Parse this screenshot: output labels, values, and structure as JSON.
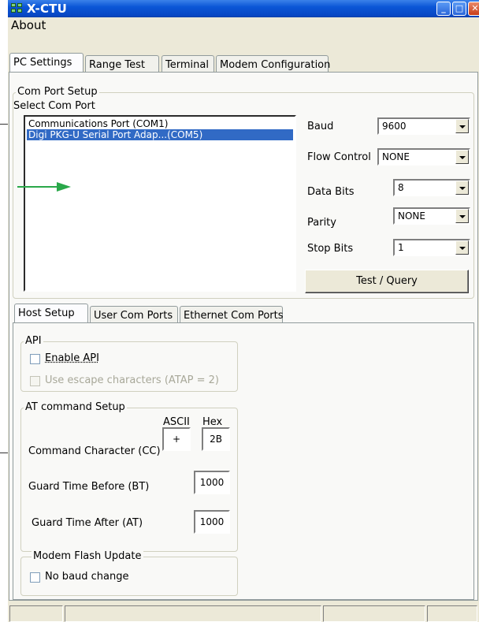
{
  "window": {
    "title": "X-CTU"
  },
  "menu": {
    "about": "About"
  },
  "main_tabs": [
    "PC Settings",
    "Range Test",
    "Terminal",
    "Modem Configuration"
  ],
  "com_port": {
    "group_title": "Com Port Setup",
    "select_label": "Select Com Port",
    "ports": [
      "Communications Port (COM1)",
      "Digi PKG-U Serial Port Adap...(COM5)"
    ],
    "selected_index": 1
  },
  "settings": {
    "baud": {
      "label": "Baud",
      "value": "9600"
    },
    "flow_control": {
      "label": "Flow Control",
      "value": "NONE"
    },
    "data_bits": {
      "label": "Data Bits",
      "value": "8"
    },
    "parity": {
      "label": "Parity",
      "value": "NONE"
    },
    "stop_bits": {
      "label": "Stop Bits",
      "value": "1"
    },
    "test_button": "Test / Query"
  },
  "sub_tabs": [
    "Host Setup",
    "User Com Ports",
    "Ethernet Com Ports"
  ],
  "api": {
    "group_title": "API",
    "enable_api": "Enable API",
    "escape_chars": "Use escape characters (ATAP = 2)"
  },
  "at_setup": {
    "group_title": "AT command Setup",
    "ascii_header": "ASCII",
    "hex_header": "Hex",
    "cc_label": "Command Character (CC)",
    "cc_ascii": "+",
    "cc_hex": "2B",
    "bt_label": "Guard Time Before (BT)",
    "bt_value": "1000",
    "at_label": "Guard Time After (AT)",
    "at_value": "1000"
  },
  "flash": {
    "group_title": "Modem Flash Update",
    "no_baud_change": "No baud change"
  },
  "colors": {
    "arrow": "#2aa84a",
    "selection": "#316ac5",
    "titlebar": "#0b56d6"
  }
}
